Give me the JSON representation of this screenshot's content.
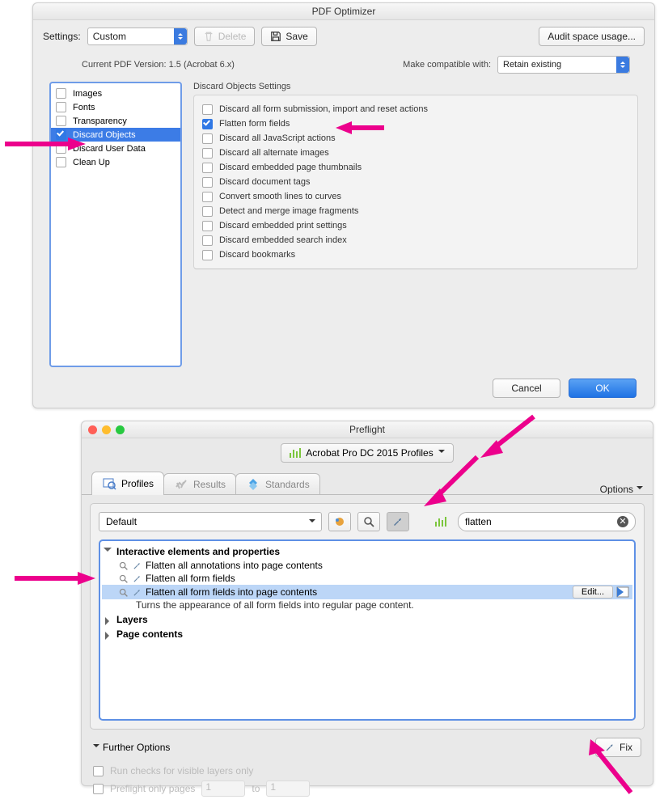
{
  "optimizer": {
    "title": "PDF Optimizer",
    "settingsLabel": "Settings:",
    "settingsValue": "Custom",
    "deleteLabel": "Delete",
    "saveLabel": "Save",
    "auditLabel": "Audit space usage...",
    "versionLine": "Current PDF Version: 1.5 (Acrobat 6.x)",
    "compatLabel": "Make compatible with:",
    "compatValue": "Retain existing",
    "categories": [
      {
        "label": "Images",
        "checked": false,
        "selected": false
      },
      {
        "label": "Fonts",
        "checked": false,
        "selected": false
      },
      {
        "label": "Transparency",
        "checked": false,
        "selected": false
      },
      {
        "label": "Discard Objects",
        "checked": true,
        "selected": true
      },
      {
        "label": "Discard User Data",
        "checked": false,
        "selected": false
      },
      {
        "label": "Clean Up",
        "checked": false,
        "selected": false
      }
    ],
    "panelTitle": "Discard Objects Settings",
    "options": [
      {
        "label": "Discard all form submission, import and reset actions",
        "checked": false
      },
      {
        "label": "Flatten form fields",
        "checked": true
      },
      {
        "label": "Discard all JavaScript actions",
        "checked": false
      },
      {
        "label": "Discard all alternate images",
        "checked": false
      },
      {
        "label": "Discard embedded page thumbnails",
        "checked": false
      },
      {
        "label": "Discard document tags",
        "checked": false
      },
      {
        "label": "Convert smooth lines to curves",
        "checked": false
      },
      {
        "label": "Detect and merge image fragments",
        "checked": false
      },
      {
        "label": "Discard embedded print settings",
        "checked": false
      },
      {
        "label": "Discard embedded search index",
        "checked": false
      },
      {
        "label": "Discard bookmarks",
        "checked": false
      }
    ],
    "cancel": "Cancel",
    "ok": "OK"
  },
  "preflight": {
    "title": "Preflight",
    "profileSet": "Acrobat Pro DC 2015 Profiles",
    "tabs": {
      "profiles": "Profiles",
      "results": "Results",
      "standards": "Standards"
    },
    "options": "Options",
    "library": "Default",
    "searchValue": "flatten",
    "group": "Interactive elements and properties",
    "entries": [
      {
        "label": "Flatten all annotations into page contents",
        "selected": false
      },
      {
        "label": "Flatten all form fields",
        "selected": false
      },
      {
        "label": "Flatten all form fields into page contents",
        "selected": true
      }
    ],
    "editLabel": "Edit...",
    "selDesc": "Turns the appearance of all form  fields into regular page content.",
    "groups2": [
      "Layers",
      "Page contents"
    ],
    "further": "Further Options",
    "fix": "Fix",
    "runChecks": "Run checks for visible layers only",
    "onlyPages": "Preflight only pages",
    "to": "to",
    "pg1": "1",
    "pg2": "1"
  }
}
